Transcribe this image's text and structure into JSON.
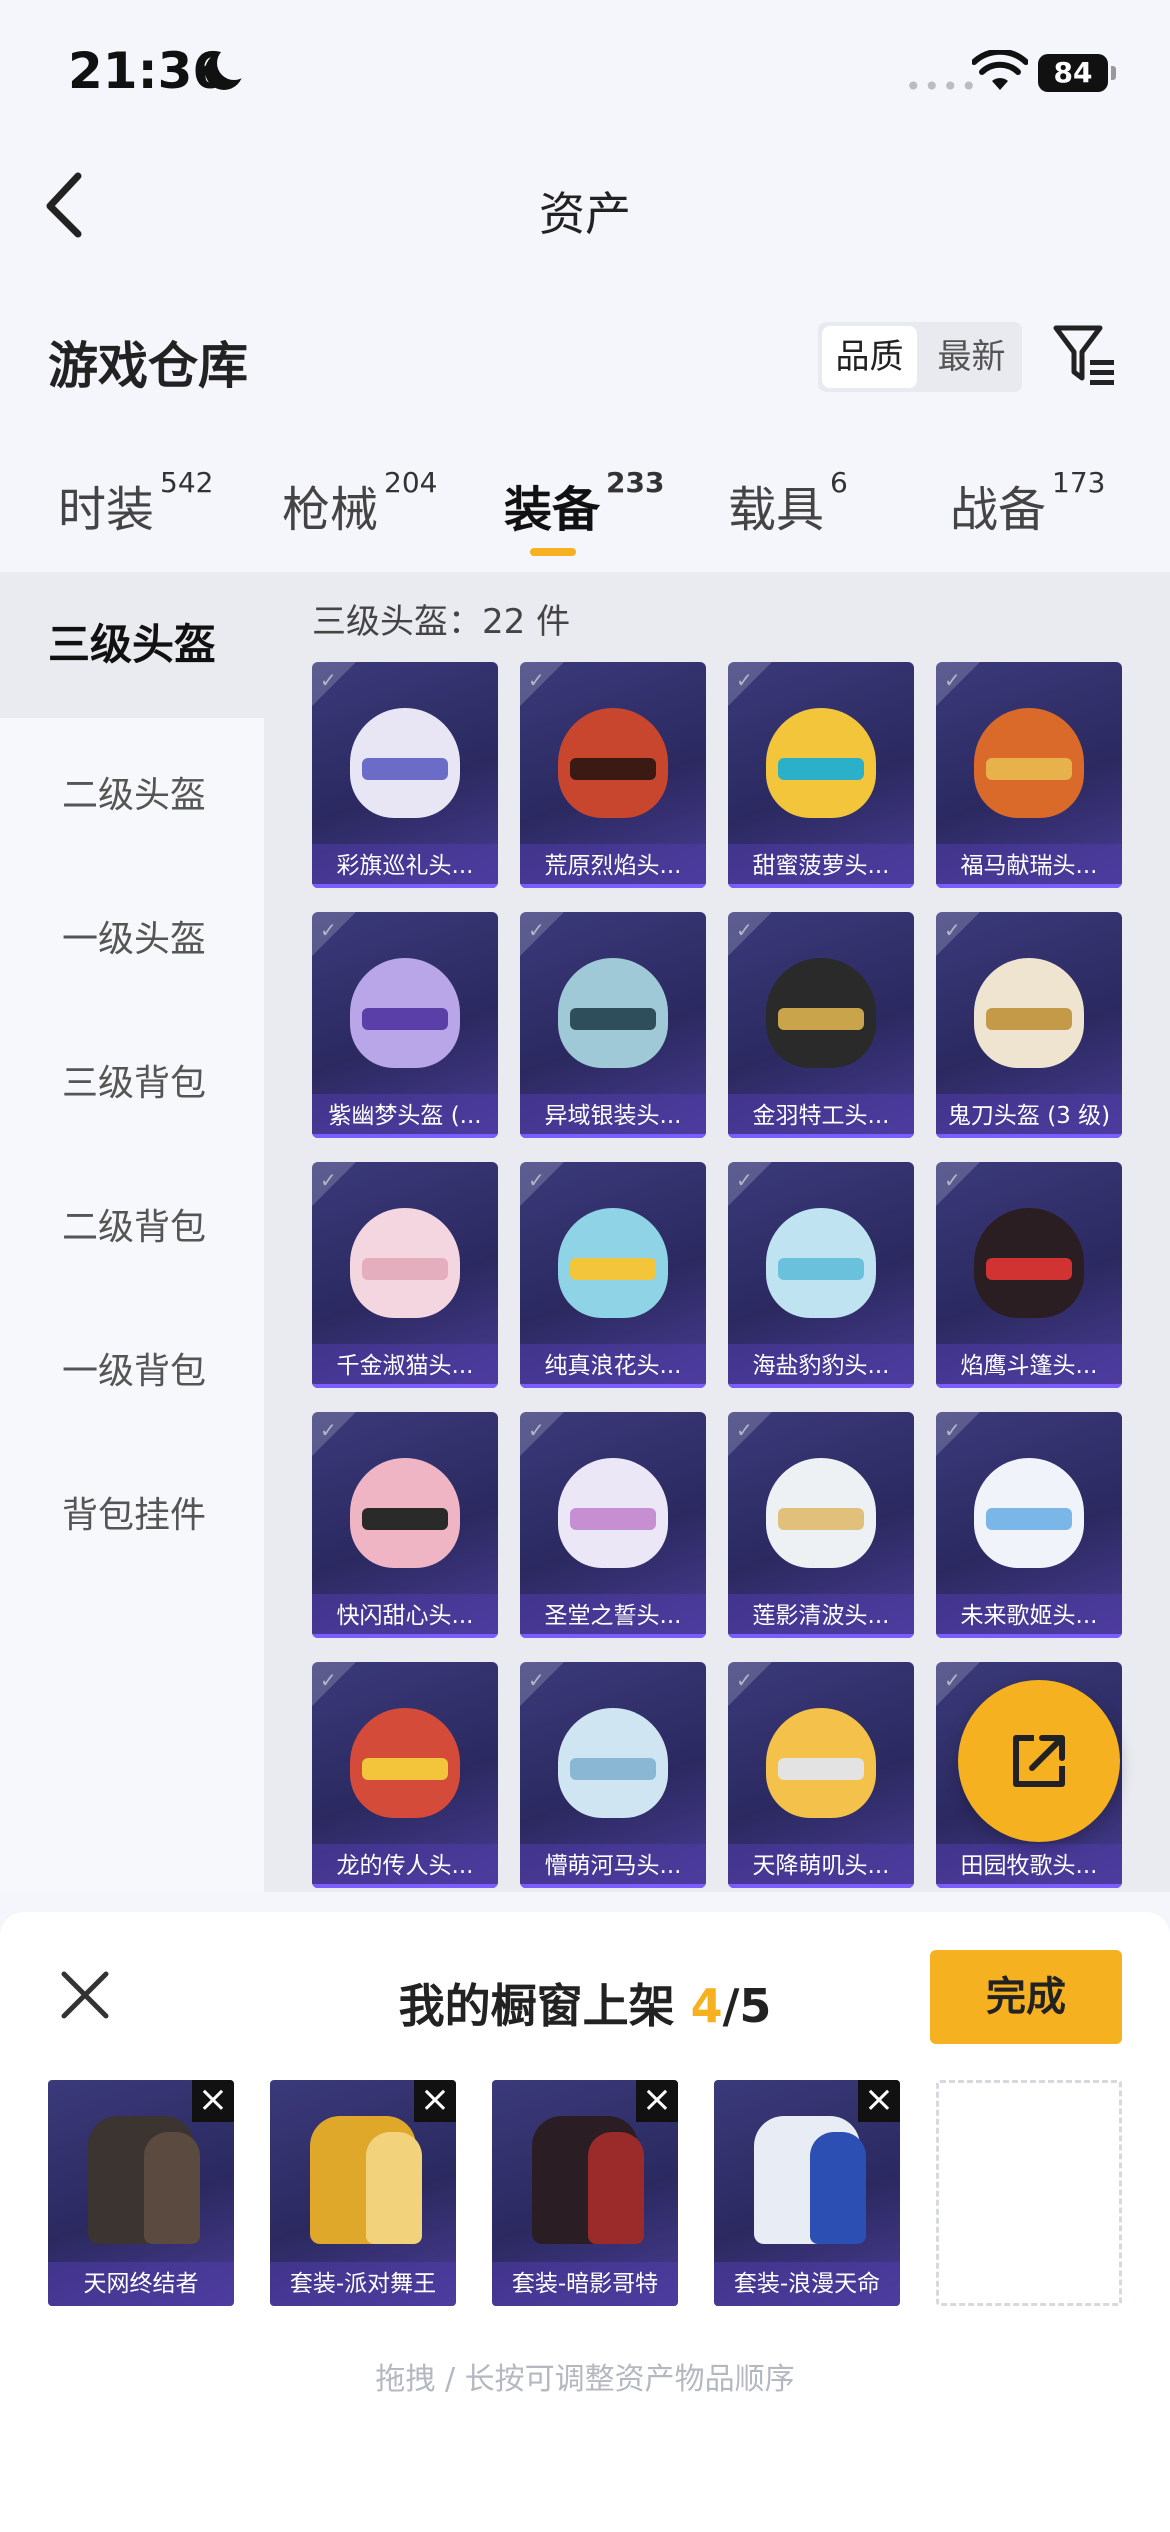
{
  "status": {
    "time": "21:36",
    "battery": "84"
  },
  "nav": {
    "title": "资产"
  },
  "warehouse": {
    "title": "游戏仓库",
    "sort_quality": "品质",
    "sort_newest": "最新"
  },
  "tabs": [
    {
      "label": "时装",
      "count": "542"
    },
    {
      "label": "枪械",
      "count": "204"
    },
    {
      "label": "装备",
      "count": "233"
    },
    {
      "label": "载具",
      "count": "6"
    },
    {
      "label": "战备",
      "count": "173"
    }
  ],
  "sidebar": [
    {
      "label": "三级头盔"
    },
    {
      "label": "二级头盔"
    },
    {
      "label": "一级头盔"
    },
    {
      "label": "三级背包"
    },
    {
      "label": "二级背包"
    },
    {
      "label": "一级背包"
    },
    {
      "label": "背包挂件"
    }
  ],
  "count_label": "三级头盔：22 件",
  "items": [
    {
      "name": "彩旗巡礼头...",
      "color": "#e8e6f4",
      "visor": "#6b6bc8"
    },
    {
      "name": "荒原烈焰头...",
      "color": "#c8452e",
      "visor": "#3b1a14"
    },
    {
      "name": "甜蜜菠萝头...",
      "color": "#f2c53a",
      "visor": "#2bb0c9"
    },
    {
      "name": "福马献瑞头...",
      "color": "#d96a2a",
      "visor": "#e7b14b"
    },
    {
      "name": "紫幽梦头盔 (...",
      "color": "#b9a6e8",
      "visor": "#5b3fa8"
    },
    {
      "name": "异域银装头...",
      "color": "#9fc9d6",
      "visor": "#2e4e5c"
    },
    {
      "name": "金羽特工头...",
      "color": "#2a2a2a",
      "visor": "#c9a44a"
    },
    {
      "name": "鬼刀头盔 (3 级)",
      "color": "#efe4d0",
      "visor": "#c49a48"
    },
    {
      "name": "千金淑猫头...",
      "color": "#f4d6e0",
      "visor": "#e5aebe"
    },
    {
      "name": "纯真浪花头...",
      "color": "#8fd3e6",
      "visor": "#f2c53a"
    },
    {
      "name": "海盐豹豹头...",
      "color": "#bfe3f0",
      "visor": "#6ac1dc"
    },
    {
      "name": "焰鹰斗篷头...",
      "color": "#2b1e22",
      "visor": "#d13232"
    },
    {
      "name": "快闪甜心头...",
      "color": "#f0b5c4",
      "visor": "#2a2a2a"
    },
    {
      "name": "圣堂之誓头...",
      "color": "#ece7f6",
      "visor": "#c58fd2"
    },
    {
      "name": "莲影清波头...",
      "color": "#eef1f4",
      "visor": "#e0c07a"
    },
    {
      "name": "未来歌姬头...",
      "color": "#f0f4fa",
      "visor": "#7ab6e8"
    },
    {
      "name": "龙的传人头...",
      "color": "#d44b3a",
      "visor": "#f2c53a"
    },
    {
      "name": "懵萌河马头...",
      "color": "#cfe5f2",
      "visor": "#8ab8d4"
    },
    {
      "name": "天降萌叽头...",
      "color": "#f4c24a",
      "visor": "#e3e3e3"
    },
    {
      "name": "田园牧歌头...",
      "color": "#e2e2e8",
      "visor": "#7d8aa0"
    }
  ],
  "showcase": {
    "title_prefix": "我的橱窗上架 ",
    "filled": "4",
    "total": "/5",
    "done_label": "完成",
    "slots": [
      {
        "name": "天网终结者",
        "color": "#3b3431",
        "accent": "#5a4a3f"
      },
      {
        "name": "套装-派对舞王",
        "color": "#e0a82a",
        "accent": "#f2d27a"
      },
      {
        "name": "套装-暗影哥特",
        "color": "#2a1e24",
        "accent": "#9b2a2a"
      },
      {
        "name": "套装-浪漫天命",
        "color": "#e7ecf5",
        "accent": "#2b4fb2"
      }
    ],
    "hint": "拖拽 / 长按可调整资产物品顺序"
  }
}
